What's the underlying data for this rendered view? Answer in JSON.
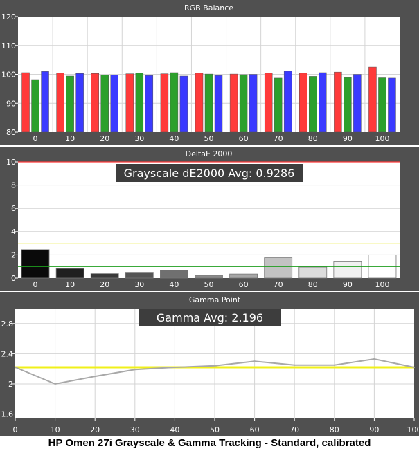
{
  "caption": "HP Omen 27i Grayscale & Gamma Tracking - Standard, calibrated",
  "colors": {
    "panel_bg": "#505050",
    "plot_bg": "#ffffff",
    "grid": "#d4d4d4",
    "axis_text": "#ffffff",
    "red": "#ff3a3a",
    "green": "#2ca02c",
    "blue": "#3a3aff",
    "threshold_high": "#e8e81c",
    "threshold_low": "#1e9e1e",
    "limit_line": "#ff3b3b",
    "gamma_target": "#f0f01a",
    "gamma_line": "#a8a8a8",
    "annotation_bg": "#3d3d3d",
    "annotation_text": "#ffffff"
  },
  "chart_data": [
    {
      "type": "bar",
      "title": "RGB Balance",
      "categories": [
        "0",
        "10",
        "20",
        "30",
        "40",
        "50",
        "60",
        "70",
        "80",
        "90",
        "100"
      ],
      "yticks": [
        "80",
        "90",
        "100",
        "110",
        "120"
      ],
      "ylim": [
        80,
        120
      ],
      "grid": true,
      "series": [
        {
          "color": "#ff3a3a",
          "values": [
            100.6,
            100.4,
            100.3,
            100.2,
            100.2,
            100.4,
            100.1,
            100.4,
            100.4,
            100.8,
            102.5
          ]
        },
        {
          "color": "#2ca02c",
          "values": [
            98.2,
            99.4,
            99.8,
            100.4,
            100.6,
            100.1,
            99.9,
            98.7,
            99.3,
            98.9,
            98.8
          ]
        },
        {
          "color": "#3a3aff",
          "values": [
            101.0,
            100.3,
            99.8,
            99.6,
            99.4,
            99.6,
            100.0,
            101.1,
            100.6,
            100.0,
            98.7
          ]
        }
      ]
    },
    {
      "type": "bar",
      "title": "DeltaE 2000",
      "annotation": "Grayscale dE2000 Avg: 0.9286",
      "categories": [
        "0",
        "10",
        "20",
        "30",
        "40",
        "50",
        "60",
        "70",
        "80",
        "90",
        "100"
      ],
      "yticks": [
        "0",
        "2",
        "4",
        "6",
        "8",
        "10"
      ],
      "ylim": [
        0,
        10
      ],
      "grid": true,
      "values": [
        2.45,
        0.82,
        0.38,
        0.5,
        0.68,
        0.24,
        0.35,
        1.75,
        0.95,
        1.4,
        2.0
      ],
      "bar_colors": [
        "#0a0a0a",
        "#202020",
        "#3a3a3a",
        "#555555",
        "#707070",
        "#8a8a8a",
        "#a6a6a6",
        "#c2c2c2",
        "#dcdcdc",
        "#f0f0f0",
        "#ffffff"
      ],
      "threshold_lines": [
        {
          "value": 3,
          "color": "#e8e81c"
        },
        {
          "value": 1,
          "color": "#1e9e1e"
        },
        {
          "value": 10,
          "color": "#ff3b3b"
        }
      ]
    },
    {
      "type": "line",
      "title": "Gamma Point",
      "annotation": "Gamma Avg: 2.196",
      "x": [
        0,
        10,
        20,
        30,
        40,
        50,
        60,
        70,
        80,
        90,
        100
      ],
      "xticks": [
        "0",
        "10",
        "20",
        "30",
        "40",
        "50",
        "60",
        "70",
        "80",
        "90",
        "100"
      ],
      "yticks": [
        "1.6",
        "2",
        "2.4",
        "2.8"
      ],
      "ylim": [
        1.55,
        3.0
      ],
      "grid": true,
      "series": [
        {
          "color": "#a8a8a8",
          "values": [
            2.22,
            2.0,
            2.1,
            2.19,
            2.22,
            2.24,
            2.3,
            2.25,
            2.25,
            2.33,
            2.22
          ]
        }
      ],
      "target": {
        "value": 2.22,
        "color": "#f0f01a"
      }
    }
  ]
}
